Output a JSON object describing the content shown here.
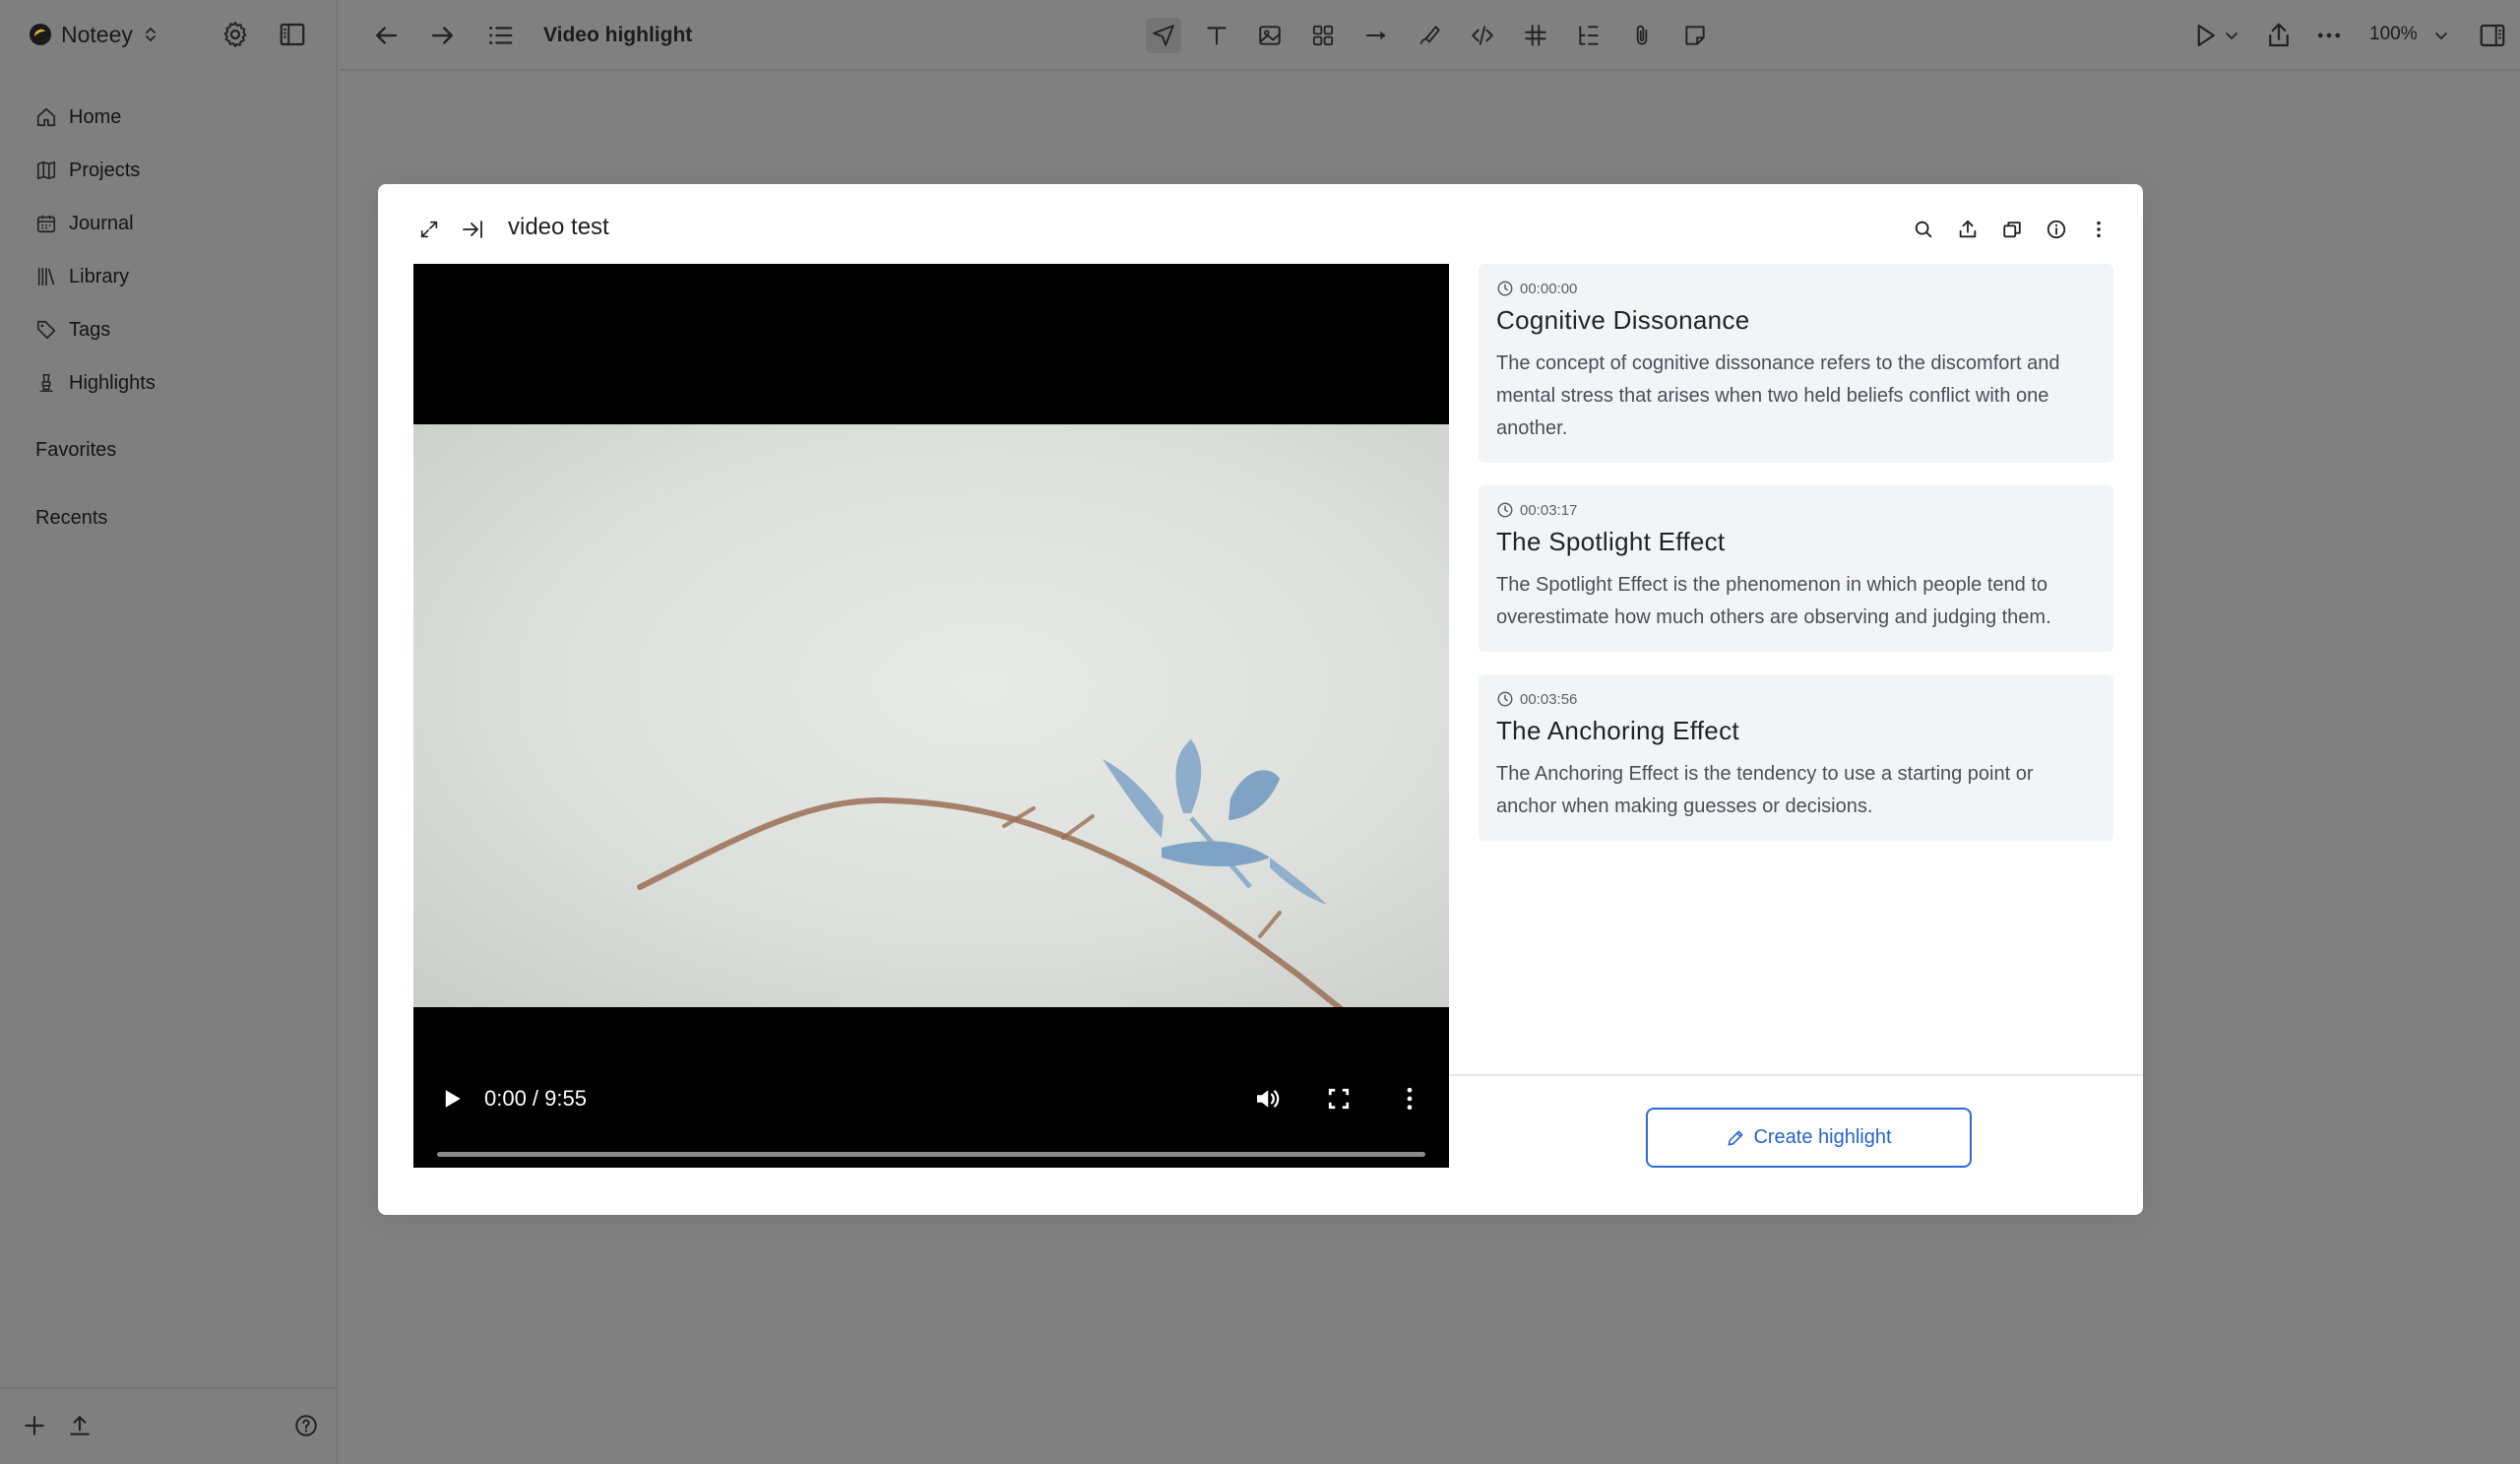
{
  "app": {
    "name": "Noteey",
    "accent": "#e3b43a"
  },
  "sidebar": {
    "nav": [
      {
        "label": "Home",
        "icon": "home-icon"
      },
      {
        "label": "Projects",
        "icon": "map-icon"
      },
      {
        "label": "Journal",
        "icon": "calendar-icon"
      },
      {
        "label": "Library",
        "icon": "library-icon"
      },
      {
        "label": "Tags",
        "icon": "tag-icon"
      },
      {
        "label": "Highlights",
        "icon": "highlighter-icon"
      }
    ],
    "favorites_label": "Favorites",
    "recents_label": "Recents"
  },
  "topbar": {
    "document_title": "Video highlight",
    "zoom": "100%"
  },
  "modal": {
    "title": "video test",
    "video": {
      "time": "0:00 / 9:55",
      "progress": 0
    },
    "highlights": [
      {
        "timestamp": "00:00:00",
        "title": "Cognitive Dissonance",
        "description": "The concept of cognitive dissonance refers to the discomfort and mental stress that arises when two held beliefs conflict with one another."
      },
      {
        "timestamp": "00:03:17",
        "title": "The Spotlight Effect",
        "description": "The Spotlight Effect is the phenomenon in which people tend to overestimate how much others are observing and judging them."
      },
      {
        "timestamp": "00:03:56",
        "title": "The Anchoring Effect",
        "description": "The Anchoring Effect is the tendency to use a starting point or anchor when making guesses or decisions."
      }
    ],
    "create_button_label": "Create highlight",
    "button_color": "#2563d0"
  }
}
